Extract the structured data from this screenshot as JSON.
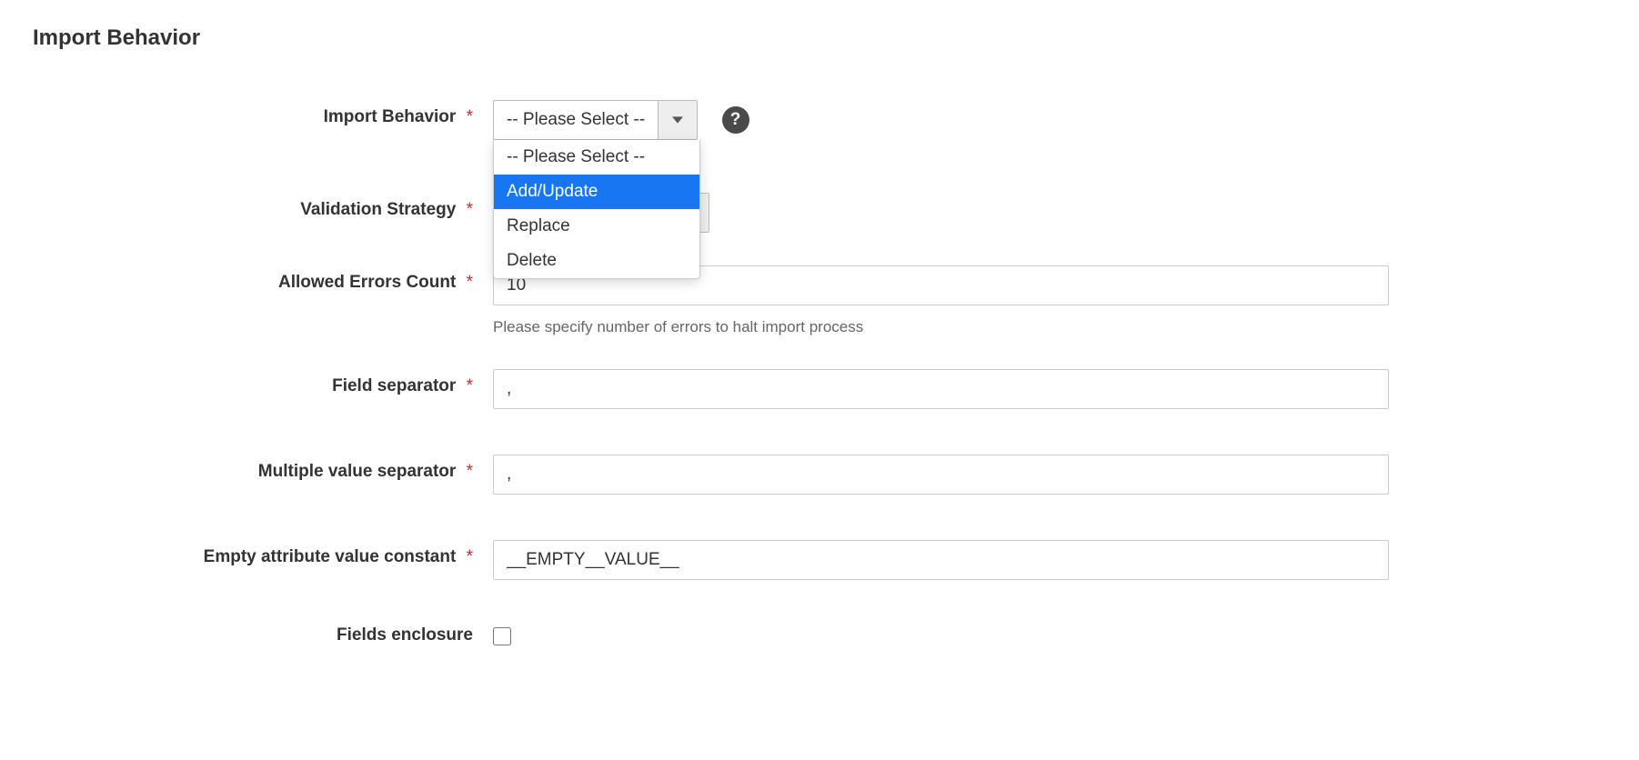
{
  "section_title": "Import Behavior",
  "fields": {
    "import_behavior": {
      "label": "Import Behavior",
      "selected": "-- Please Select --",
      "options": [
        "-- Please Select --",
        "Add/Update",
        "Replace",
        "Delete"
      ],
      "highlighted_index": 1
    },
    "validation_strategy": {
      "label": "Validation Strategy"
    },
    "allowed_errors": {
      "label": "Allowed Errors Count",
      "value": "10",
      "hint": "Please specify number of errors to halt import process"
    },
    "field_separator": {
      "label": "Field separator",
      "value": ","
    },
    "multi_separator": {
      "label": "Multiple value separator",
      "value": ","
    },
    "empty_value": {
      "label": "Empty attribute value constant",
      "value": "__EMPTY__VALUE__"
    },
    "fields_enclosure": {
      "label": "Fields enclosure",
      "checked": false
    }
  },
  "required_marker": "*",
  "help_glyph": "?"
}
